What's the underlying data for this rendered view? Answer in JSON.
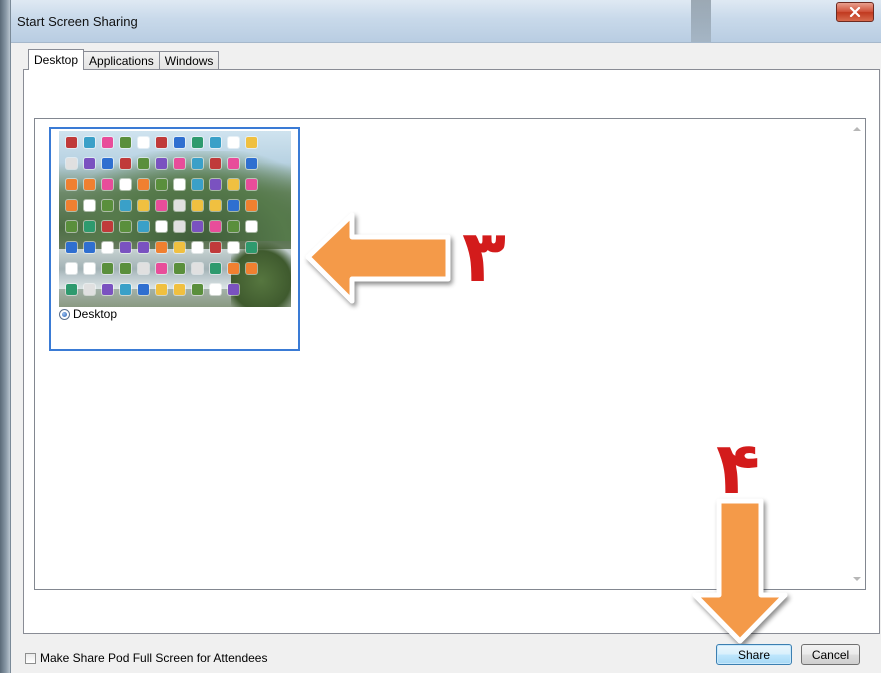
{
  "window": {
    "title": "Start Screen Sharing",
    "close_label": "x"
  },
  "tabs": [
    {
      "label": "Desktop",
      "active": true
    },
    {
      "label": "Applications",
      "active": false
    },
    {
      "label": "Windows",
      "active": false
    }
  ],
  "list": {
    "items": [
      {
        "label": "Desktop",
        "selected": true
      }
    ]
  },
  "annotations": {
    "step3": "٣",
    "step4": "۴",
    "arrow_color": "#f49a4a",
    "number_color": "#d31b1b"
  },
  "footer": {
    "fullscreen_checkbox_label": "Make Share Pod Full Screen for Attendees",
    "fullscreen_checked": false,
    "share_label": "Share",
    "cancel_label": "Cancel"
  },
  "colors": {
    "selection_border": "#3a7bd5",
    "close_button": "#c0391f"
  }
}
